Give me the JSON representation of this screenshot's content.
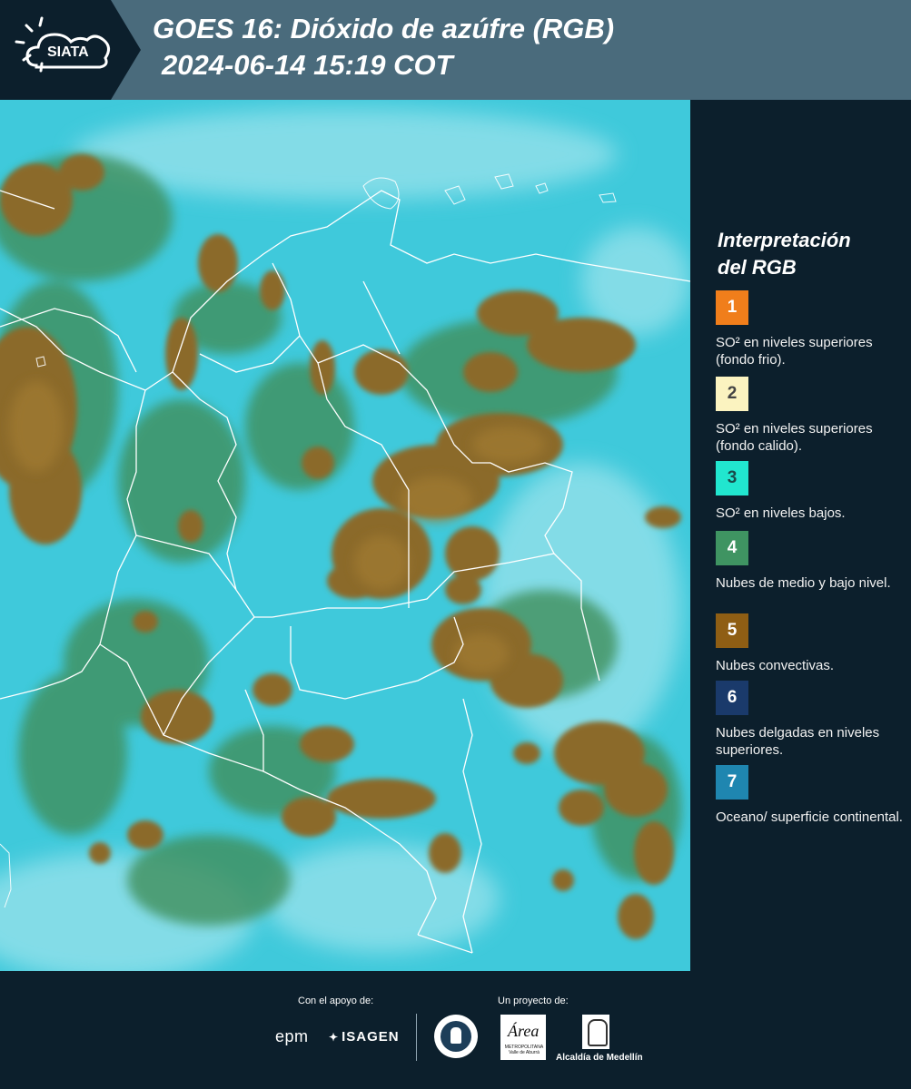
{
  "header": {
    "brand": "SIATA",
    "title_line1": "GOES 16: Dióxido de azúfre (RGB)",
    "title_line2": "2024-06-14 15:19 COT"
  },
  "legend": {
    "title_line1": "Interpretación",
    "title_line2": "del RGB",
    "items": [
      {
        "number": "1",
        "color": "#f07e1b",
        "text_color": "#ffffff",
        "label": "SO² en niveles superiores (fondo frio)."
      },
      {
        "number": "2",
        "color": "#fbf3c0",
        "text_color": "#444444",
        "label": "SO² en niveles superiores (fondo calido)."
      },
      {
        "number": "3",
        "color": "#21e6cf",
        "text_color": "#1a4a4a",
        "label": "SO² en niveles bajos."
      },
      {
        "number": "4",
        "color": "#3f9462",
        "text_color": "#ffffff",
        "label": "Nubes de medio y bajo nivel."
      },
      {
        "number": "5",
        "color": "#8f5e14",
        "text_color": "#ffffff",
        "label": "Nubes convectivas."
      },
      {
        "number": "6",
        "color": "#1a3a6b",
        "text_color": "#ffffff",
        "label": "Nubes delgadas en niveles superiores."
      },
      {
        "number": "7",
        "color": "#1f86b0",
        "text_color": "#ffffff",
        "label": "Oceano/ superficie continental."
      }
    ]
  },
  "footer": {
    "support_label": "Con el apoyo de:",
    "project_label": "Un proyecto de:",
    "sponsor_epm": "epm",
    "sponsor_isagen": "ISAGEN",
    "area_logo_word": "Área",
    "area_logo_sub": "METROPOLITANA Valle de Aburrá",
    "alcaldia": "Alcaldía de Medellín"
  },
  "map": {
    "colors": {
      "base": "#3fc9db",
      "haze": "#8fe0ea",
      "green_cloud": "#3f8f5c",
      "dark_green": "#2f6b46",
      "convective": "#8b6a2a",
      "convective_light": "#a07a32",
      "border": "#ffffff"
    }
  }
}
